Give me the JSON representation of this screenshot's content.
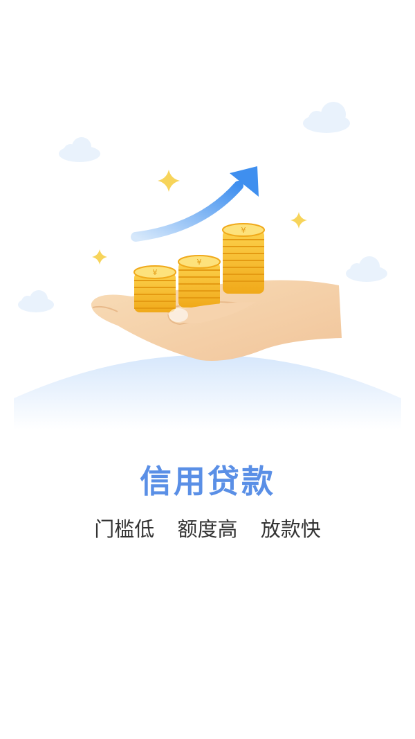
{
  "splash": {
    "title": "信用贷款",
    "features": [
      "门槛低",
      "额度高",
      "放款快"
    ]
  },
  "illustration": {
    "coin_symbol": "¥",
    "coin_stacks": 3,
    "icons": [
      "cloud-icon",
      "sparkle-icon",
      "growth-arrow-icon",
      "coin-stack-icon",
      "hand-icon"
    ]
  },
  "colors": {
    "title": "#5a8fe6",
    "text": "#333333",
    "coin": "#f6b51d",
    "coin_dark": "#e49a12",
    "arrow": "#5aa6f2",
    "hand": "#f6d3ad",
    "cloud": "#e9f2fc",
    "sparkle": "#f7d45a"
  }
}
